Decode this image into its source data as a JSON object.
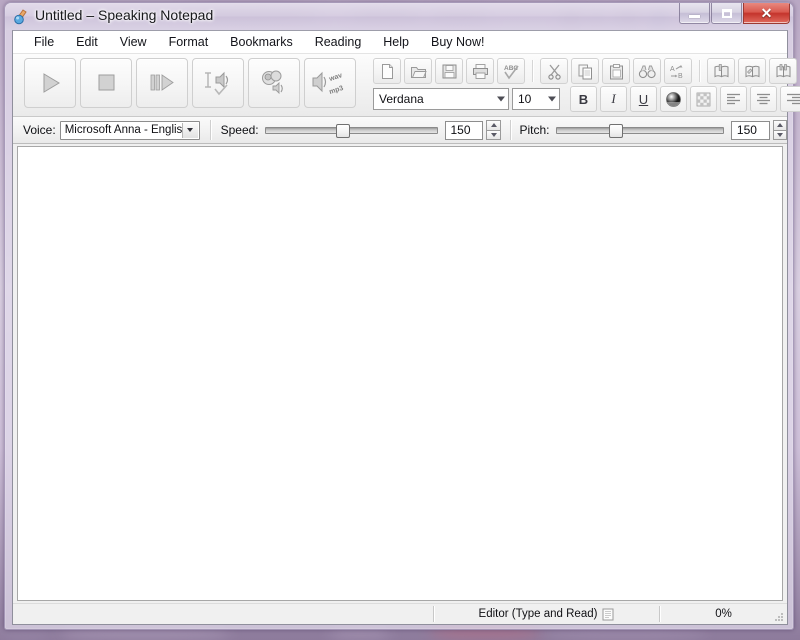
{
  "window": {
    "title": "Untitled – Speaking Notepad",
    "app_icon": "speaking-notepad-icon",
    "controls": {
      "minimize": "Minimize",
      "maximize": "Maximize",
      "close": "Close",
      "close_glyph": "✕"
    }
  },
  "menubar": {
    "items": [
      {
        "label": "File"
      },
      {
        "label": "Edit"
      },
      {
        "label": "View"
      },
      {
        "label": "Format"
      },
      {
        "label": "Bookmarks"
      },
      {
        "label": "Reading"
      },
      {
        "label": "Help"
      },
      {
        "label": "Buy Now!"
      }
    ]
  },
  "toolbar_speech": {
    "buttons": [
      {
        "name": "play-button",
        "tooltip": "Play"
      },
      {
        "name": "stop-button",
        "tooltip": "Stop"
      },
      {
        "name": "pause-button",
        "tooltip": "Pause"
      },
      {
        "name": "read-from-cursor-button",
        "tooltip": "Read from cursor"
      },
      {
        "name": "voices-button",
        "tooltip": "Voices"
      },
      {
        "name": "export-audio-button",
        "tooltip": "Save as WAV / MP3",
        "label_wav": "wav",
        "label_mp3": "mp3"
      }
    ]
  },
  "toolbar_file": {
    "buttons": [
      {
        "name": "new-button",
        "tooltip": "New"
      },
      {
        "name": "open-button",
        "tooltip": "Open"
      },
      {
        "name": "save-button",
        "tooltip": "Save"
      },
      {
        "name": "print-button",
        "tooltip": "Print"
      },
      {
        "name": "spellcheck-button",
        "tooltip": "Spelling",
        "glyph": "ABC"
      },
      {
        "name": "cut-button",
        "tooltip": "Cut"
      },
      {
        "name": "copy-button",
        "tooltip": "Copy"
      },
      {
        "name": "paste-button",
        "tooltip": "Paste"
      },
      {
        "name": "find-button",
        "tooltip": "Find"
      },
      {
        "name": "replace-button",
        "tooltip": "Replace",
        "glyph_a": "A",
        "glyph_b": "B"
      },
      {
        "name": "add-bookmark-button",
        "tooltip": "Add bookmark"
      },
      {
        "name": "edit-bookmark-button",
        "tooltip": "Edit bookmark"
      },
      {
        "name": "goto-bookmark-button",
        "tooltip": "Go to bookmark"
      }
    ],
    "overflow_caret": "▾"
  },
  "toolbar_format": {
    "font_name": "Verdana",
    "font_size": "10",
    "buttons": [
      {
        "name": "bold-button",
        "label": "B"
      },
      {
        "name": "italic-button",
        "label": "I"
      },
      {
        "name": "underline-button",
        "label": "U"
      },
      {
        "name": "font-color-button",
        "label": ""
      },
      {
        "name": "highlight-color-button",
        "label": ""
      },
      {
        "name": "align-left-button",
        "label": ""
      },
      {
        "name": "align-center-button",
        "label": ""
      },
      {
        "name": "align-right-button",
        "label": ""
      }
    ]
  },
  "speech_bar": {
    "voice_label": "Voice:",
    "voice_value": "Microsoft Anna - English",
    "speed_label": "Speed:",
    "speed_value": "150",
    "speed_percent": 45,
    "pitch_label": "Pitch:",
    "pitch_value": "150",
    "pitch_percent": 35
  },
  "editor": {
    "content": ""
  },
  "statusbar": {
    "mode_text": "Editor (Type and Read)",
    "mode_icon": "document-icon",
    "progress_text": "0%"
  },
  "colors": {
    "accent": "#c4342c",
    "frame": "#c6b7d0",
    "chrome": "#f0f0f0",
    "editor_bg": "#ffffff"
  }
}
